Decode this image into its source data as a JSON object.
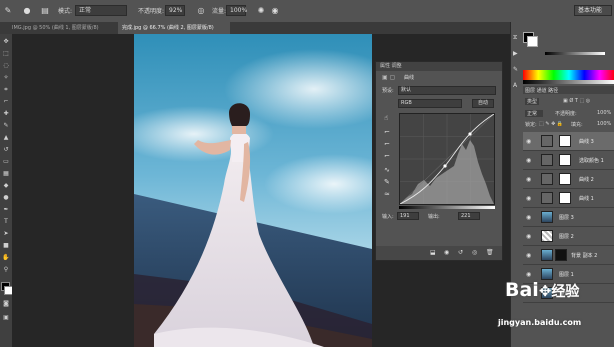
{
  "options_bar": {
    "mode_label": "模式:",
    "mode_value": "正常",
    "opacity_label": "不透明度:",
    "opacity_value": "92%",
    "flow_label": "流量:",
    "flow_value": "100%",
    "workspace": "基本功能"
  },
  "tabs": [
    {
      "label": "IMG.jpg @ 50% (曲线 1, 图层蒙版/8)"
    },
    {
      "label": "完成.jpg @ 66.7% (曲线 2, 图层蒙版/8)"
    }
  ],
  "curves_panel": {
    "panel_tabs": "属性  调整",
    "title": "曲线",
    "preset_label": "预设:",
    "preset_value": "默认",
    "channel_value": "RGB",
    "auto_label": "自动",
    "input_label": "输入:",
    "input_value": "191",
    "output_label": "输出:",
    "output_value": "221"
  },
  "layers_panel": {
    "tabs": "图层  通道  路径",
    "kind_value": "类型",
    "blend_value": "正常",
    "opacity_label": "不透明度:",
    "opacity_value": "100%",
    "lock_label": "锁定:",
    "fill_label": "填充:",
    "fill_value": "100%",
    "layers": [
      {
        "name": "曲线 3",
        "type": "adjustment",
        "selected": true
      },
      {
        "name": "选取颜色 1",
        "type": "adjustment",
        "selected": false
      },
      {
        "name": "曲线 2",
        "type": "adjustment",
        "selected": false
      },
      {
        "name": "曲线 1",
        "type": "adjustment",
        "selected": false
      },
      {
        "name": "图层 3",
        "type": "pixel",
        "selected": false
      },
      {
        "name": "图层 2",
        "type": "pixel",
        "selected": false
      },
      {
        "name": "背景 副本 2",
        "type": "pixel",
        "selected": false
      },
      {
        "name": "图层 1",
        "type": "pixel",
        "selected": false
      },
      {
        "name": "背景",
        "type": "pixel",
        "selected": false
      }
    ]
  },
  "watermark": {
    "brand": "Bai",
    "brand_suffix": "经验",
    "url": "jingyan.baidu.com"
  }
}
